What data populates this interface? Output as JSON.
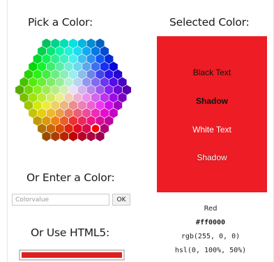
{
  "picker": {
    "title": "Pick a Color:",
    "selected_cell_color": "#ff0000"
  },
  "manual": {
    "title": "Or Enter a Color:",
    "placeholder": "Colorvalue",
    "ok_label": "OK"
  },
  "html5": {
    "title": "Or Use HTML5:",
    "value": "#e02020"
  },
  "selected": {
    "title": "Selected Color:",
    "color": "#ee1c24",
    "black_text": "Black Text",
    "black_shadow": "Shadow",
    "white_text": "White Text",
    "white_shadow": "Shadow",
    "name": "Red",
    "hex": "#ff0000",
    "rgb": "rgb(255, 0, 0)",
    "hsl": "hsl(0, 100%, 50%)"
  }
}
